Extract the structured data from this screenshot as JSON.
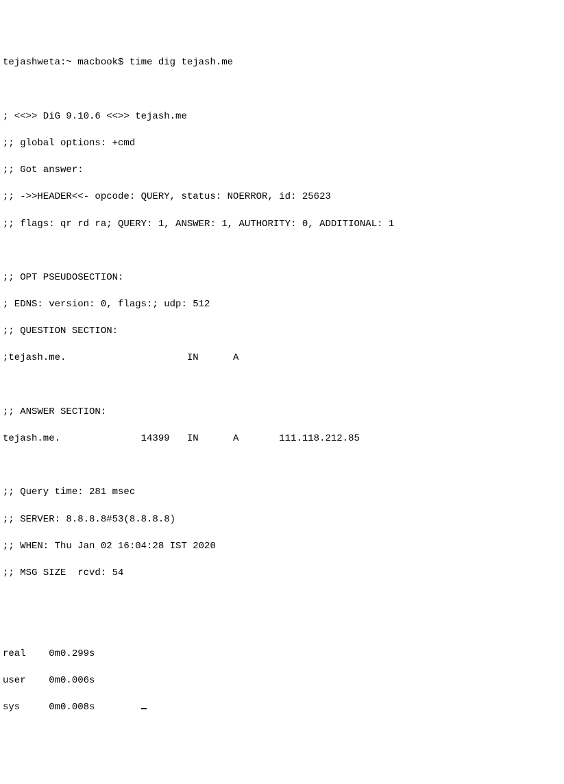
{
  "prompt": {
    "user_host": "tejashweta:~ macbook$",
    "command": "time dig tejash.me"
  },
  "dig": {
    "banner": "; <<>> DiG 9.10.6 <<>> tejash.me",
    "global_options": ";; global options: +cmd",
    "got_answer": ";; Got answer:",
    "header": ";; ->>HEADER<<- opcode: QUERY, status: NOERROR, id: 25623",
    "flags": ";; flags: qr rd ra; QUERY: 1, ANSWER: 1, AUTHORITY: 0, ADDITIONAL: 1",
    "opt_header": ";; OPT PSEUDOSECTION:",
    "edns": "; EDNS: version: 0, flags:; udp: 512",
    "question_header": ";; QUESTION SECTION:",
    "question_line": ";tejash.me.                     IN      A",
    "answer_header": ";; ANSWER SECTION:",
    "answer_line": "tejash.me.              14399   IN      A       111.118.212.85",
    "query_time": ";; Query time: 281 msec",
    "server": ";; SERVER: 8.8.8.8#53(8.8.8.8)",
    "when": ";; WHEN: Thu Jan 02 16:04:28 IST 2020",
    "msg_size": ";; MSG SIZE  rcvd: 54"
  },
  "time": {
    "real": "real    0m0.299s",
    "user": "user    0m0.006s",
    "sys": "sys     0m0.008s"
  }
}
